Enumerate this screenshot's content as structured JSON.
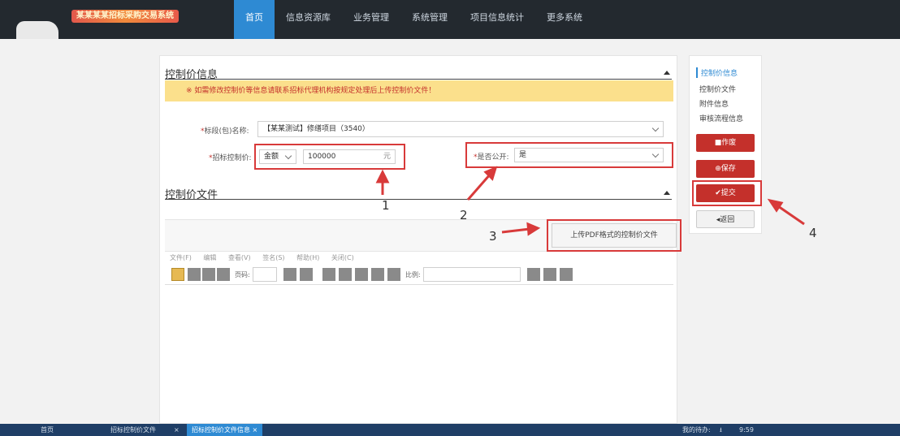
{
  "header": {
    "logo_text": "某某某某招标采购交易系统",
    "nav": [
      {
        "label": "首页",
        "active": true
      },
      {
        "label": "信息资源库",
        "active": false
      },
      {
        "label": "业务管理",
        "active": false
      },
      {
        "label": "系统管理",
        "active": false
      },
      {
        "label": "项目信息统计",
        "active": false
      },
      {
        "label": "更多系统",
        "active": false
      }
    ]
  },
  "section1": {
    "title": "控制价信息",
    "notice": "※ 如需修改控制价等信息请联系招标代理机构按规定处理后上传控制价文件！",
    "project_label": "标段(包)名称:",
    "project_value": "【某某测试】修缮项目（3540）",
    "price_label": "招标控制价:",
    "price_type": "金额",
    "price_value": "100000",
    "price_unit": "元",
    "public_label": "是否公开:",
    "public_value": "是"
  },
  "section2": {
    "title": "控制价文件",
    "upload_button": "上传PDF格式的控制价文件",
    "menu": [
      "文件(F)",
      "编辑",
      "查看(V)",
      "签名(S)",
      "帮助(H)",
      "关闭(C)"
    ],
    "page_label": "页码:",
    "zoom_label": "比例:"
  },
  "sidebar": {
    "links": [
      {
        "label": "控制价信息",
        "active": true
      },
      {
        "label": "控制价文件",
        "active": false
      },
      {
        "label": "附件信息",
        "active": false
      },
      {
        "label": "审核流程信息",
        "active": false
      }
    ],
    "buttons": {
      "void": "■作废",
      "save": "⊕保存",
      "submit": "✔提交",
      "back": "◂返回"
    }
  },
  "annotations": [
    "1",
    "2",
    "3",
    "4"
  ],
  "taskbar": {
    "home": "首页",
    "tab1": "招标控制价文件",
    "tab2": "招标控制价文件信息",
    "right_label": "我的待办:",
    "time": "9:59"
  },
  "colors": {
    "nav_bg": "#23292f",
    "nav_active": "#2e8ad3",
    "notice_bg": "#fbe08c",
    "primary_button": "#c4302b",
    "highlight_box": "#d83a3a"
  }
}
